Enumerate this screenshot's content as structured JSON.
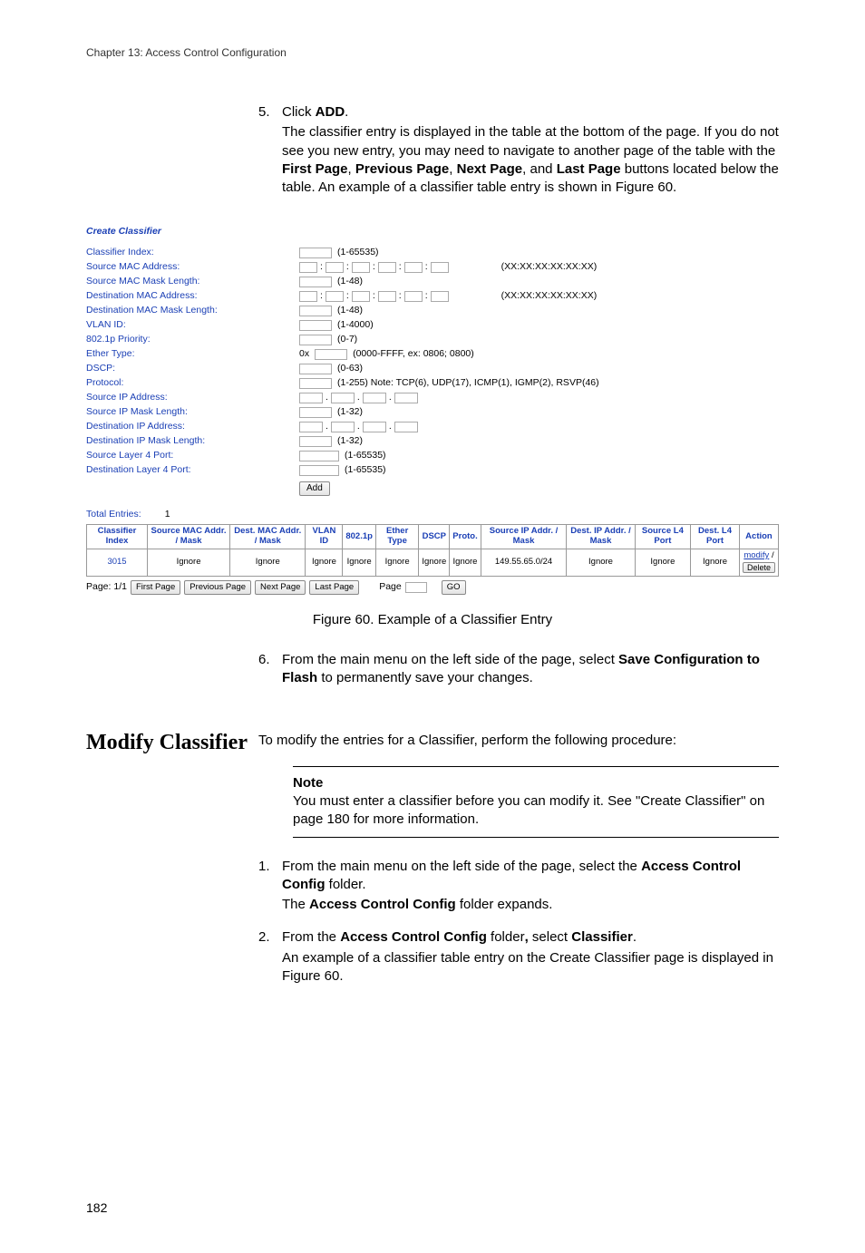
{
  "header": {
    "chapter": "Chapter 13: Access Control Configuration"
  },
  "step5": {
    "num": "5.",
    "line1a": "Click ",
    "line1b": "ADD",
    "line1c": ".",
    "para_a": "The classifier entry is displayed in the table at the bottom of the page. If you do not see you new entry, you may need to navigate to another page of the table with the ",
    "fp": "First Page",
    "sep1": ", ",
    "pp": "Previous Page",
    "sep2": ", ",
    "np": "Next Page",
    "sep3": ", and ",
    "lp": "Last Page",
    "para_b": " buttons located below the table. An example of a classifier table entry is shown in Figure 60."
  },
  "figure": {
    "title": "Create Classifier",
    "labels": {
      "idx": "Classifier Index:",
      "smac": "Source MAC Address:",
      "smacml": "Source MAC Mask Length:",
      "dmac": "Destination MAC Address:",
      "dmacml": "Destination MAC Mask Length:",
      "vlan": "VLAN ID:",
      "prio": "802.1p Priority:",
      "etype": "Ether Type:",
      "dscp": "DSCP:",
      "proto": "Protocol:",
      "sip": "Source IP Address:",
      "sipml": "Source IP Mask Length:",
      "dip": "Destination IP Address:",
      "dipml": "Destination IP Mask Length:",
      "sl4": "Source Layer 4 Port:",
      "dl4": "Destination Layer 4 Port:"
    },
    "hints": {
      "idx": "(1-65535)",
      "mac": "(XX:XX:XX:XX:XX:XX)",
      "macml": "(1-48)",
      "vlan": "(1-4000)",
      "prio": "(0-7)",
      "etype_prefix": "0x",
      "etype": "(0000-FFFF, ex: 0806; 0800)",
      "dscp": "(0-63)",
      "proto": "(1-255) Note: TCP(6), UDP(17), ICMP(1), IGMP(2), RSVP(46)",
      "ipml": "(1-32)",
      "l4": "(1-65535)"
    },
    "add_btn": "Add",
    "total_label": "Total Entries:",
    "total_count": "1",
    "table": {
      "headers": [
        "Classifier Index",
        "Source MAC Addr. / Mask",
        "Dest. MAC Addr. / Mask",
        "VLAN ID",
        "802.1p",
        "Ether Type",
        "DSCP",
        "Proto.",
        "Source IP Addr. / Mask",
        "Dest. IP Addr. / Mask",
        "Source L4 Port",
        "Dest. L4 Port",
        "Action"
      ],
      "row": {
        "idx": "3015",
        "smac": "Ignore",
        "dmac": "Ignore",
        "vlan": "Ignore",
        "p8021": "Ignore",
        "etype": "Ignore",
        "dscp": "Ignore",
        "proto": "Ignore",
        "sip": "149.55.65.0/24",
        "dip": "Ignore",
        "sl4": "Ignore",
        "dl4": "Ignore",
        "modify": "modify",
        "slash": " / ",
        "delete": "Delete"
      }
    },
    "pager": {
      "page_label": "Page: 1/1",
      "first": "First Page",
      "prev": "Previous Page",
      "next": "Next Page",
      "last": "Last Page",
      "page_word": "Page",
      "go": "GO"
    },
    "caption": "Figure 60. Example of a Classifier Entry"
  },
  "step6": {
    "num": "6.",
    "a": "From the main menu on the left side of the page, select ",
    "b": "Save Configuration to Flash",
    "c": " to permanently save your changes."
  },
  "modify": {
    "title": "Modify Classifier",
    "intro": "To modify the entries for a Classifier, perform the following procedure:",
    "note_title": "Note",
    "note_body": "You must enter a classifier before you can modify it. See \"Create Classifier\" on page 180 for more information.",
    "s1": {
      "num": "1.",
      "a": "From the main menu on the left side of the page, select the ",
      "b": "Access Control Config",
      "c": " folder.",
      "d": "The ",
      "e": "Access Control Config",
      "f": " folder expands."
    },
    "s2": {
      "num": "2.",
      "a": "From the ",
      "b": "Access Control Config",
      "c": " folder",
      "d": ",",
      "e": " select ",
      "f": "Classifier",
      "g": ".",
      "h": "An example of a classifier table entry on the Create Classifier page is displayed in Figure 60."
    }
  },
  "page_number": "182"
}
